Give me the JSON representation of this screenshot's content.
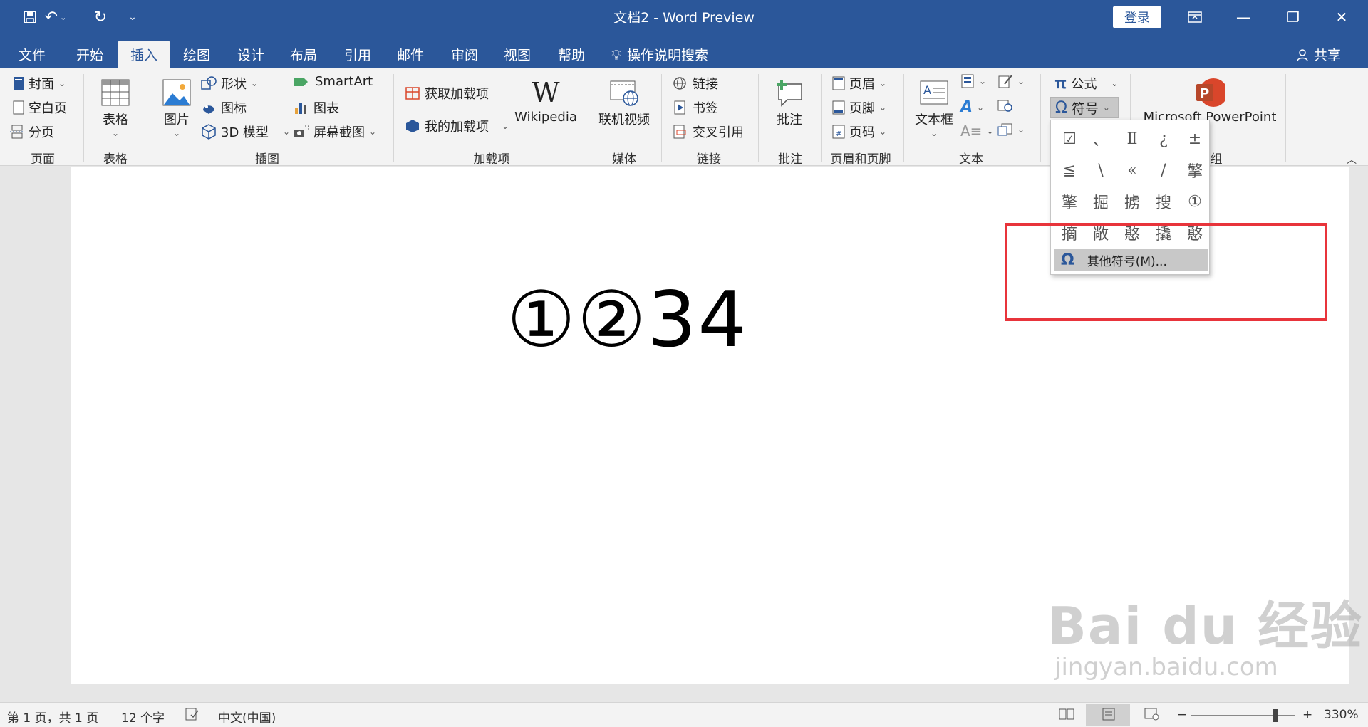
{
  "titlebar": {
    "title": "文档2  -  Word Preview",
    "login": "登录",
    "qa_save_icon": "save-icon",
    "qa_undo_icon": "undo-icon",
    "qa_redo_icon": "redo-icon"
  },
  "tabs": [
    "文件",
    "开始",
    "插入",
    "绘图",
    "设计",
    "布局",
    "引用",
    "邮件",
    "审阅",
    "视图",
    "帮助"
  ],
  "active_tab": "插入",
  "tell_me": "操作说明搜索",
  "share": "共享",
  "ribbon": {
    "pages": {
      "cover": "封面",
      "blank": "空白页",
      "break": "分页",
      "label": "页面"
    },
    "tables": {
      "table": "表格",
      "label": "表格"
    },
    "illustrations": {
      "picture": "图片",
      "shapes": "形状",
      "icons": "图标",
      "model3d": "3D 模型",
      "smartart": "SmartArt",
      "chart": "图表",
      "screenshot": "屏幕截图",
      "label": "插图"
    },
    "addins": {
      "get": "获取加载项",
      "mine": "我的加载项",
      "wikipedia": "Wikipedia",
      "label": "加载项"
    },
    "media": {
      "video": "联机视频",
      "label": "媒体"
    },
    "links": {
      "link": "链接",
      "bookmark": "书签",
      "crossref": "交叉引用",
      "label": "链接"
    },
    "comments": {
      "comment": "批注",
      "label": "批注"
    },
    "header_footer": {
      "header": "页眉",
      "footer": "页脚",
      "pagenum": "页码",
      "label": "页眉和页脚"
    },
    "text": {
      "textbox": "文本框",
      "label": "文本"
    },
    "symbols": {
      "equation": "公式",
      "symbol": "符号"
    },
    "powerpoint": {
      "label": "Microsoft PowerPoint",
      "group_tail": "组"
    }
  },
  "symbol_panel": {
    "symbols": [
      "☑",
      "、",
      "Ⅱ",
      "¿",
      "±",
      "≦",
      "\\",
      "«",
      "/",
      "擎",
      "擎",
      "掘",
      "掳",
      "搜",
      "①",
      "摘",
      "敞",
      "憨",
      "撬",
      "憨"
    ],
    "more": "其他符号(M)..."
  },
  "document": {
    "text": "①②34"
  },
  "watermark": {
    "main": "Bai du 经验",
    "sub": "jingyan.baidu.com"
  },
  "statusbar": {
    "page": "第 1 页，共 1 页",
    "words": "12 个字",
    "language": "中文(中国)",
    "zoom": "330%"
  }
}
